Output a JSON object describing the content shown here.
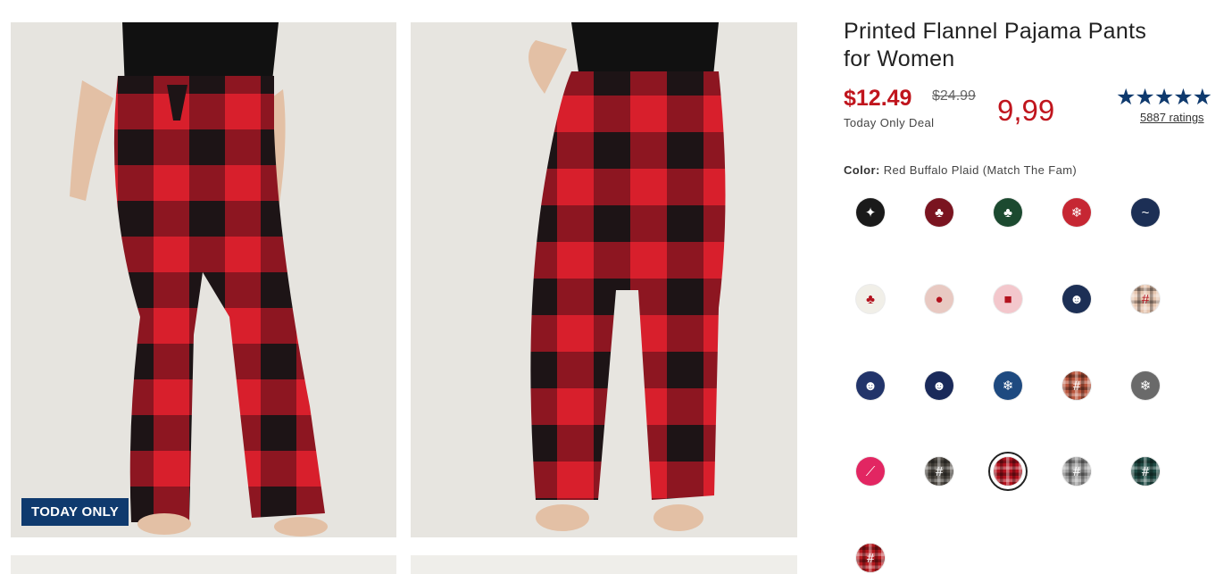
{
  "product": {
    "title_line1": "Printed Flannel Pajama Pants",
    "title_line2": "for Women",
    "price": "$12.49",
    "was_price": "$24.99",
    "deal_label": "Today Only Deal",
    "alt_price": "9,99",
    "stars": "★★★★★",
    "ratings": "5887 ratings",
    "rating_fraction": 1.0
  },
  "gallery": {
    "badge": "TODAY ONLY",
    "plaid_red": "#d81f2c",
    "plaid_dark": "#1d1416"
  },
  "color": {
    "label": "Color:",
    "value": "Red Buffalo Plaid (Match The Fam)",
    "selected_index": 17
  },
  "swatches": [
    {
      "name": "swatch-new-year",
      "bg": "#1a1a1a",
      "icon": "text-pattern-icon",
      "glyph": "✦"
    },
    {
      "name": "swatch-red-trees",
      "bg": "#7a1420",
      "icon": "tree-icon",
      "glyph": "♣"
    },
    {
      "name": "swatch-green-trees",
      "bg": "#1c4a30",
      "icon": "tree-icon",
      "glyph": "♣"
    },
    {
      "name": "swatch-red-fairisle",
      "bg": "#c62733",
      "icon": "snowflake-icon",
      "glyph": "❄"
    },
    {
      "name": "swatch-navy-script",
      "bg": "#1c2f55",
      "icon": "script-icon",
      "glyph": "~"
    },
    {
      "name": "swatch-cream-trees",
      "bg": "#f1efe8",
      "icon": "tree-icon",
      "glyph": "♣"
    },
    {
      "name": "swatch-pink-ornament",
      "bg": "#e8c9c2",
      "icon": "ornament-icon",
      "glyph": "●"
    },
    {
      "name": "swatch-pink-gifts",
      "bg": "#f3c7cc",
      "icon": "gift-icon",
      "glyph": "■"
    },
    {
      "name": "swatch-navy-santa",
      "bg": "#1c2f55",
      "icon": "santa-icon",
      "glyph": "☻"
    },
    {
      "name": "swatch-tan-plaid",
      "bg": "#e6c6b0",
      "icon": "plaid-icon",
      "glyph": "#"
    },
    {
      "name": "swatch-blue-santa",
      "bg": "#22346a",
      "icon": "santa-icon",
      "glyph": "☻"
    },
    {
      "name": "swatch-navy-santa-2",
      "bg": "#1a2a5a",
      "icon": "santa-icon",
      "glyph": "☻"
    },
    {
      "name": "swatch-blue-snow",
      "bg": "#1e4a80",
      "icon": "snowflake-icon",
      "glyph": "❄"
    },
    {
      "name": "swatch-rust-plaid",
      "bg": "#b9573f",
      "icon": "plaid-icon",
      "glyph": "#"
    },
    {
      "name": "swatch-gray-fairisle",
      "bg": "#6a6a6a",
      "icon": "snowflake-icon",
      "glyph": "❄"
    },
    {
      "name": "swatch-pink-candycane",
      "bg": "#e22662",
      "icon": "candycane-icon",
      "glyph": "⟋"
    },
    {
      "name": "swatch-multi-plaid",
      "bg": "#4f4a44",
      "icon": "plaid-icon",
      "glyph": "#"
    },
    {
      "name": "swatch-red-buffalo-plaid",
      "bg": "#b3121e",
      "icon": "plaid-icon",
      "glyph": ""
    },
    {
      "name": "swatch-bw-check",
      "bg": "#9d9d9d",
      "icon": "plaid-icon",
      "glyph": "#"
    },
    {
      "name": "swatch-green-plaid",
      "bg": "#1f4a44",
      "icon": "plaid-icon",
      "glyph": "#"
    },
    {
      "name": "swatch-tartan",
      "bg": "#b41a1f",
      "icon": "plaid-icon",
      "glyph": "#"
    }
  ]
}
